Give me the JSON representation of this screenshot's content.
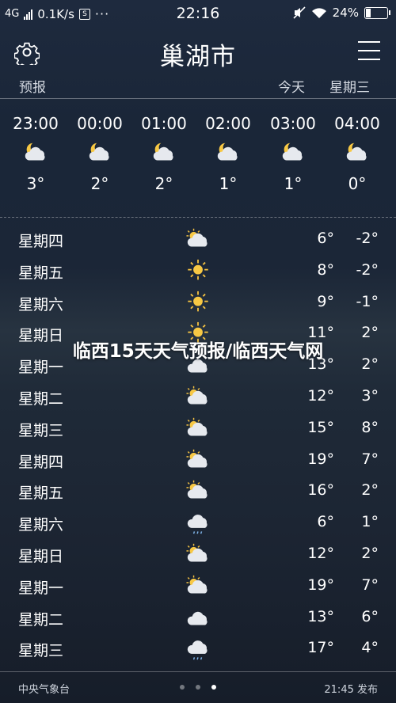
{
  "status": {
    "network": "4G",
    "speed": "0.1K/s",
    "sim_icon": "S",
    "more": "···",
    "time": "22:16",
    "battery": "24%",
    "battery_level": 0.24
  },
  "header": {
    "city": "巢湖市"
  },
  "subbar": {
    "forecast": "预报",
    "today": "今天",
    "weekday": "星期三"
  },
  "hourly": [
    {
      "time": "23:00",
      "icon": "moon-cloud-icon",
      "temp": "3°"
    },
    {
      "time": "00:00",
      "icon": "moon-cloud-icon",
      "temp": "2°"
    },
    {
      "time": "01:00",
      "icon": "moon-cloud-icon",
      "temp": "2°"
    },
    {
      "time": "02:00",
      "icon": "moon-cloud-icon",
      "temp": "1°"
    },
    {
      "time": "03:00",
      "icon": "moon-cloud-icon",
      "temp": "1°"
    },
    {
      "time": "04:00",
      "icon": "moon-cloud-icon",
      "temp": "0°"
    }
  ],
  "daily": [
    {
      "day": "星期四",
      "icon": "partly-cloudy-icon",
      "hi": "6°",
      "lo": "-2°"
    },
    {
      "day": "星期五",
      "icon": "sun-icon",
      "hi": "8°",
      "lo": "-2°"
    },
    {
      "day": "星期六",
      "icon": "sun-icon",
      "hi": "9°",
      "lo": "-1°"
    },
    {
      "day": "星期日",
      "icon": "sun-icon",
      "hi": "11°",
      "lo": "2°"
    },
    {
      "day": "星期一",
      "icon": "cloud-icon",
      "hi": "13°",
      "lo": "2°"
    },
    {
      "day": "星期二",
      "icon": "partly-cloudy-icon",
      "hi": "12°",
      "lo": "3°"
    },
    {
      "day": "星期三",
      "icon": "partly-cloudy-icon",
      "hi": "15°",
      "lo": "8°"
    },
    {
      "day": "星期四",
      "icon": "partly-cloudy-icon",
      "hi": "19°",
      "lo": "7°"
    },
    {
      "day": "星期五",
      "icon": "partly-cloudy-icon",
      "hi": "16°",
      "lo": "2°"
    },
    {
      "day": "星期六",
      "icon": "rain-cloud-icon",
      "hi": "6°",
      "lo": "1°"
    },
    {
      "day": "星期日",
      "icon": "partly-cloudy-icon",
      "hi": "12°",
      "lo": "2°"
    },
    {
      "day": "星期一",
      "icon": "partly-cloudy-icon",
      "hi": "19°",
      "lo": "7°"
    },
    {
      "day": "星期二",
      "icon": "cloud-icon",
      "hi": "13°",
      "lo": "6°"
    },
    {
      "day": "星期三",
      "icon": "rain-cloud-icon",
      "hi": "17°",
      "lo": "4°"
    }
  ],
  "overlay_title": "临西15天天气预报/临西天气网",
  "footer": {
    "source": "中央气象台",
    "published": "21:45 发布",
    "pages": 3,
    "active_page": 3
  }
}
